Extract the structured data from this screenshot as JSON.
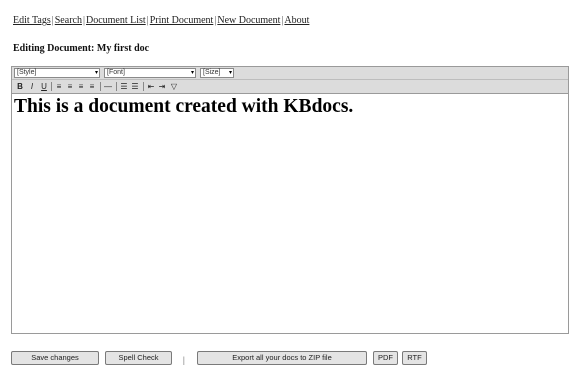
{
  "nav": {
    "links": [
      "Edit Tags",
      "Search",
      "Document List",
      "Print Document",
      "New Document",
      "About"
    ],
    "separator": "|"
  },
  "heading": "Editing Document: My first doc",
  "toolbar": {
    "style_select": "[Style]",
    "font_select": "[Font]",
    "size_select": "[Size]",
    "dropdown_arrow": "▾",
    "bold": "B",
    "italic": "I",
    "underline": "U",
    "align_left_icon": "≡",
    "align_center_icon": "≡",
    "align_right_icon": "≡",
    "justify_icon": "≡",
    "hr_icon": "—",
    "ordered_list_icon": "☰",
    "unordered_list_icon": "☰",
    "outdent_icon": "⇤",
    "indent_icon": "⇥",
    "more_icon": "▽"
  },
  "editor_content": "This is a document created with KBdocs.",
  "buttons": {
    "save": "Save changes",
    "spell": "Spell Check",
    "divider": "|",
    "export_zip": "Export all your docs to ZIP file",
    "pdf": "PDF",
    "rtf": "RTF"
  }
}
